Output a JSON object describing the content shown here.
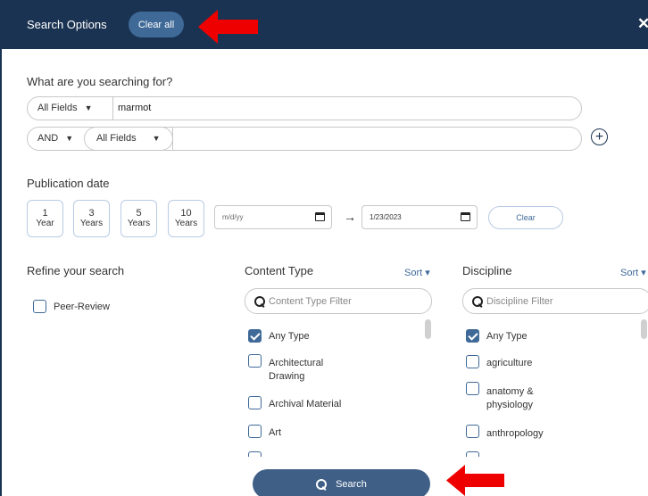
{
  "header": {
    "title": "Search Options",
    "clear_all_label": "Clear all",
    "close_glyph": "✕"
  },
  "query": {
    "heading": "What are you searching for?",
    "row1": {
      "field": "All Fields",
      "value": "marmot"
    },
    "row2": {
      "operator": "AND",
      "field": "All Fields",
      "value": ""
    },
    "add_icon": "plus-circle-icon"
  },
  "publication": {
    "heading": "Publication date",
    "ranges": [
      {
        "n": "1",
        "u": "Year"
      },
      {
        "n": "3",
        "u": "Years"
      },
      {
        "n": "5",
        "u": "Years"
      },
      {
        "n": "10",
        "u": "Years"
      }
    ],
    "from_placeholder": "m/d/yy",
    "to_value": "1/23/2023",
    "clear_label": "Clear"
  },
  "refine": {
    "heading": "Refine your search",
    "peer_review_label": "Peer-Review",
    "peer_review_checked": false
  },
  "content_type": {
    "heading": "Content Type",
    "sort_label": "Sort ▾",
    "filter_placeholder": "Content Type Filter",
    "items": [
      {
        "label": "Any Type",
        "checked": true
      },
      {
        "label": "Architectural Drawing",
        "checked": false
      },
      {
        "label": "Archival Material",
        "checked": false
      },
      {
        "label": "Art",
        "checked": false
      }
    ]
  },
  "discipline": {
    "heading": "Discipline",
    "sort_label": "Sort ▾",
    "filter_placeholder": "Discipline Filter",
    "items": [
      {
        "label": "Any Type",
        "checked": true
      },
      {
        "label": "agriculture",
        "checked": false
      },
      {
        "label": "anatomy & physiology",
        "checked": false
      },
      {
        "label": "anthropology",
        "checked": false
      }
    ]
  },
  "search_button_label": "Search",
  "colors": {
    "navy": "#1b3352",
    "accent": "#3f6a98",
    "arrow_red": "#ee0000"
  }
}
